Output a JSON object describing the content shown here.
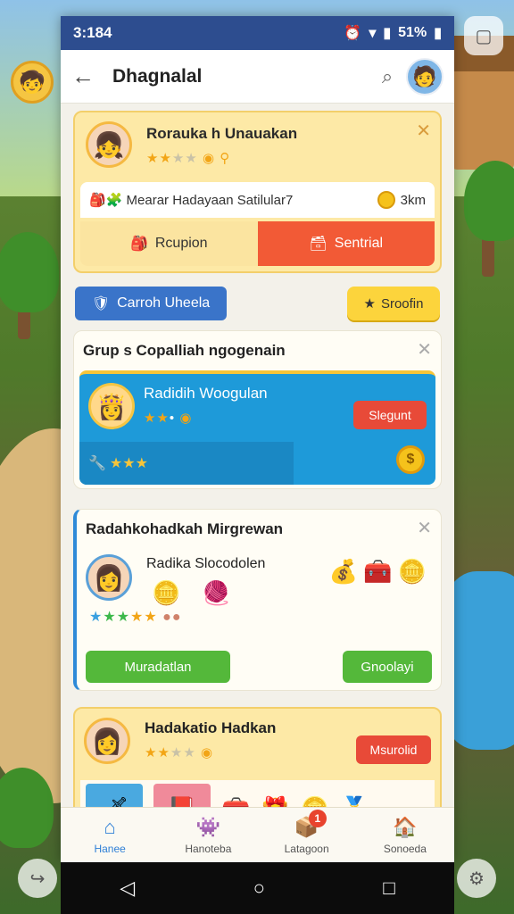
{
  "status": {
    "time": "3:184",
    "battery": "51%"
  },
  "appbar": {
    "title": "Dhagnalal"
  },
  "card1": {
    "name": "Rorauka h Unauakan",
    "info": "Mearar Hadayaan Satilular7",
    "distance": "3km",
    "btn_left": "Rcupion",
    "btn_right": "Sentrial"
  },
  "chip_blue": "Carroh Uheela",
  "chip_yellow": "Sroofin",
  "card2": {
    "heading": "Grup s Copalliah ngogenain",
    "name": "Radidih Woogulan",
    "action": "Slegunt"
  },
  "card3": {
    "heading": "Radahkohadkah Mirgrewan",
    "name": "Radika Slocodolen",
    "btn1": "Muradatlan",
    "btn2": "Gnoolayi"
  },
  "card4": {
    "name": "Hadakatio Hadkan",
    "action": "Msurolid"
  },
  "nav": [
    {
      "label": "Hanee",
      "icon": "home-icon"
    },
    {
      "label": "Hanoteba",
      "icon": "monster-icon"
    },
    {
      "label": "Latagoon",
      "icon": "box-icon",
      "badge": "1"
    },
    {
      "label": "Sonoeda",
      "icon": "house-icon"
    }
  ],
  "colors": {
    "statusbar": "#2d4d8f",
    "accent_red": "#f25a36",
    "accent_blue": "#1e9ad9",
    "accent_green": "#54b83a"
  }
}
